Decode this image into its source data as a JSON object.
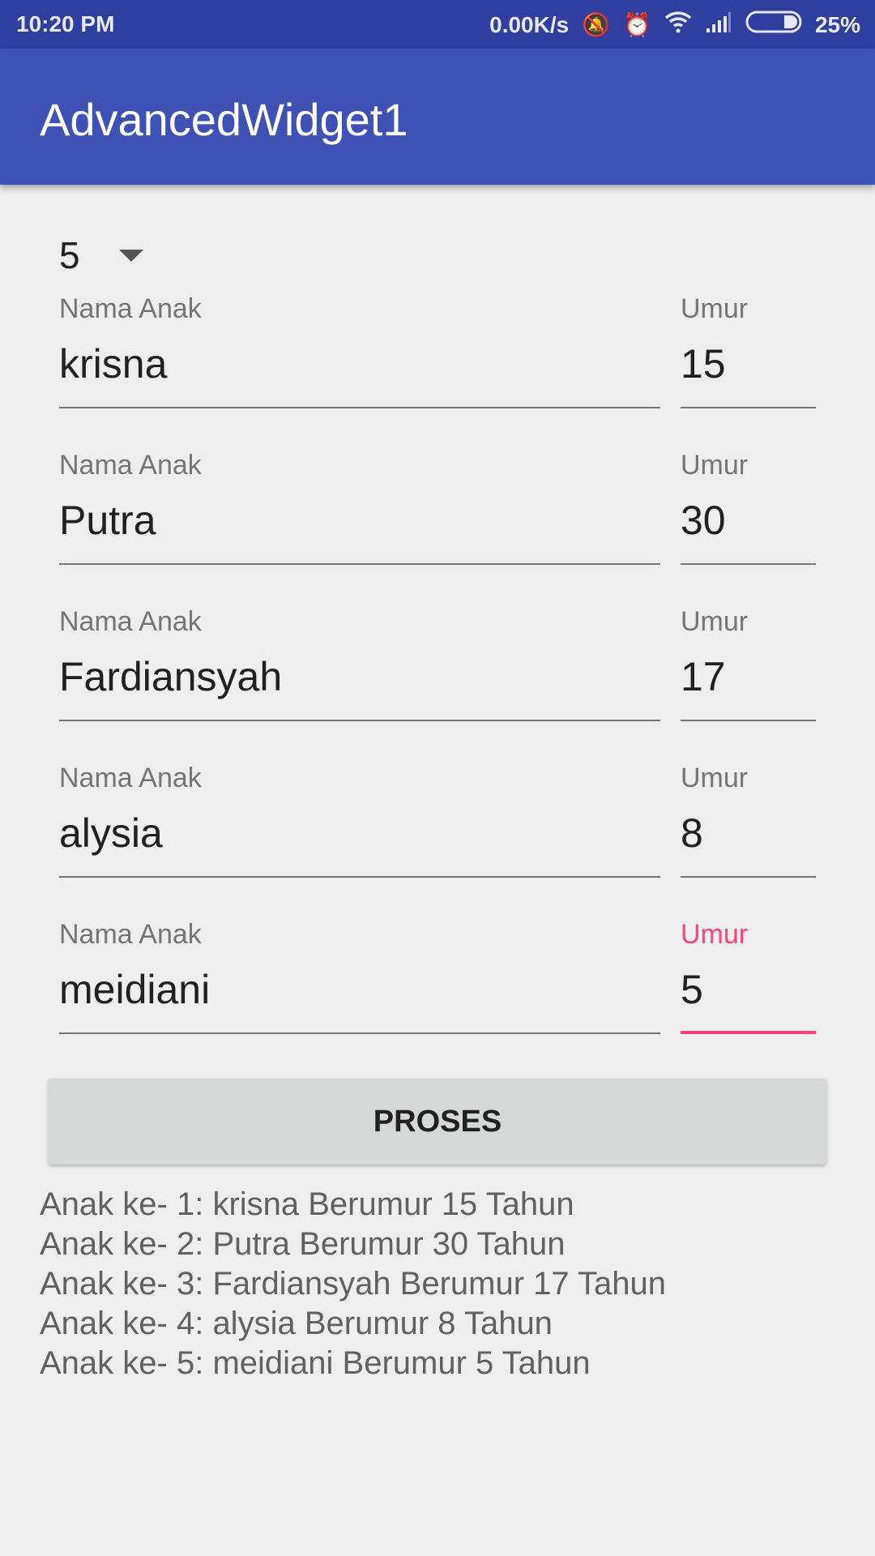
{
  "status": {
    "time": "10:20 PM",
    "speed": "0.00K/s",
    "battery": "25%"
  },
  "app": {
    "title": "AdvancedWidget1"
  },
  "spinner": {
    "value": "5"
  },
  "rows": [
    {
      "name_label": "Nama Anak",
      "name": "krisna",
      "age_label": "Umur",
      "age": "15"
    },
    {
      "name_label": "Nama Anak",
      "name": "Putra",
      "age_label": "Umur",
      "age": "30"
    },
    {
      "name_label": "Nama Anak",
      "name": "Fardiansyah",
      "age_label": "Umur",
      "age": "17"
    },
    {
      "name_label": "Nama Anak",
      "name": "alysia",
      "age_label": "Umur",
      "age": "8"
    },
    {
      "name_label": "Nama Anak",
      "name": "meidiani",
      "age_label": "Umur",
      "age": "5"
    }
  ],
  "button": {
    "label": "PROSES"
  },
  "results": [
    "Anak ke- 1: krisna Berumur 15 Tahun",
    "Anak ke- 2: Putra Berumur 30 Tahun",
    "Anak ke- 3: Fardiansyah Berumur 17 Tahun",
    "Anak ke- 4: alysia Berumur 8 Tahun",
    "Anak ke- 5: meidiani Berumur 5 Tahun"
  ],
  "colors": {
    "primary": "#3f51b5",
    "primary_dark": "#303f9f",
    "accent": "#ff4081"
  }
}
